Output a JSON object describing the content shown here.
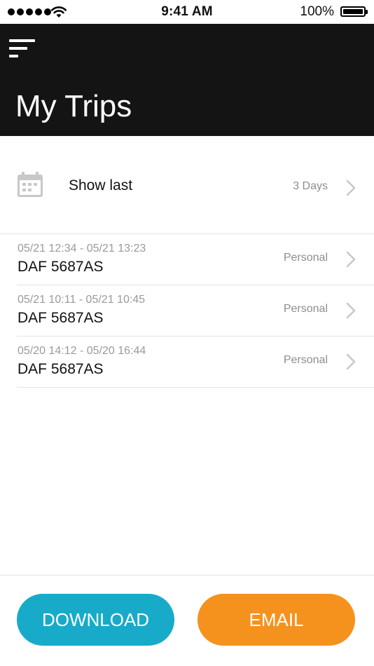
{
  "status_bar": {
    "time": "9:41 AM",
    "battery_percent": "100%",
    "icons": [
      "signal-dots-icon",
      "wifi-icon",
      "battery-icon"
    ]
  },
  "header": {
    "menu_icon": "menu-icon",
    "title": "My Trips",
    "background": "#141414"
  },
  "filter": {
    "icon": "calendar-icon",
    "label": "Show last",
    "value": "3 Days"
  },
  "trips": [
    {
      "time_range": "05/21 12:34 - 05/21 13:23",
      "vehicle": "DAF 5687AS",
      "type": "Personal"
    },
    {
      "time_range": "05/21 10:11 - 05/21 10:45",
      "vehicle": "DAF 5687AS",
      "type": "Personal"
    },
    {
      "time_range": "05/20 14:12 - 05/20 16:44",
      "vehicle": "DAF 5687AS",
      "type": "Personal"
    }
  ],
  "actions": {
    "download_label": "DOWNLOAD",
    "email_label": "EMAIL",
    "download_color": "#17abc9",
    "email_color": "#f5921e"
  }
}
